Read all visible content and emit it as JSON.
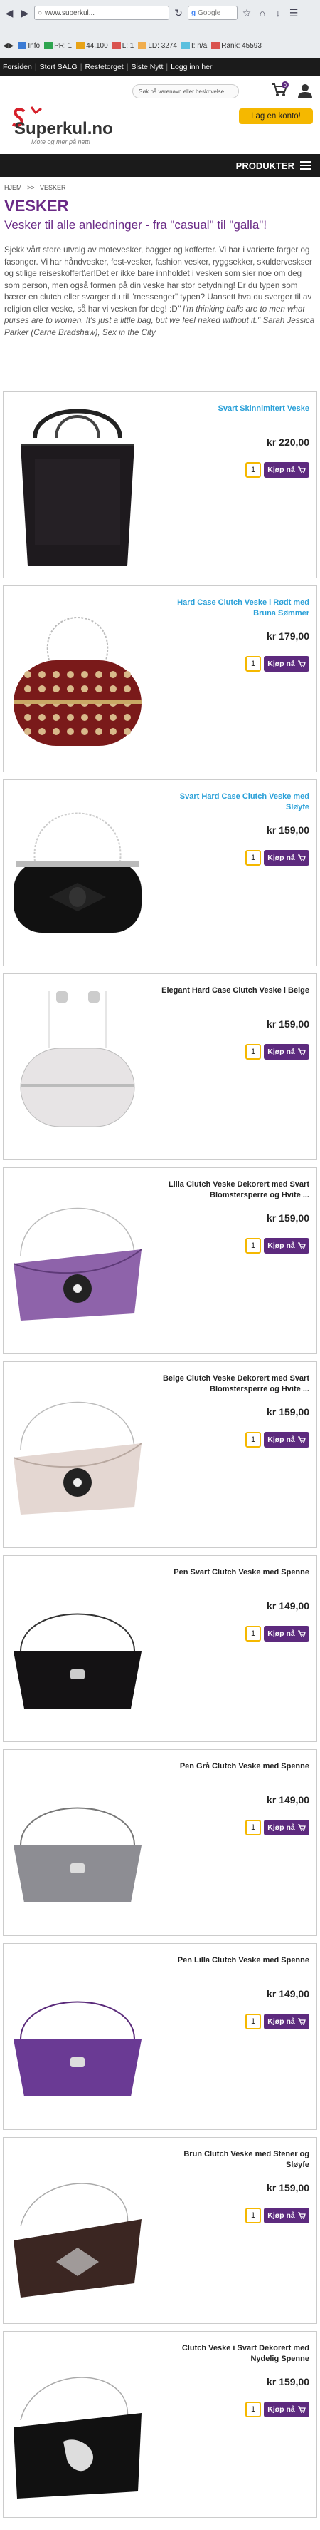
{
  "browser": {
    "url": "www.superkul...",
    "search_placeholder": "Google",
    "toolbar_items": [
      {
        "label": "Info",
        "icon": "info-icon"
      },
      {
        "label": "PR: 1",
        "icon": "pagerank-icon"
      },
      {
        "label": "44,100",
        "icon": "alexa-icon"
      },
      {
        "label": "L: 1",
        "icon": "links-icon"
      },
      {
        "label": "LD: 3274",
        "icon": "linking-domains-icon"
      },
      {
        "label": "I: n/a",
        "icon": "index-icon"
      },
      {
        "label": "Rank: 45593",
        "icon": "rank-icon"
      }
    ]
  },
  "topnav": {
    "items": [
      "Forsiden",
      "Stort SALG",
      "Restetorget",
      "Siste Nytt",
      "Logg inn her"
    ]
  },
  "header": {
    "search_placeholder": "Søk på varenavn eller beskrivelse",
    "cart_count": "0",
    "logo_text": "Superkul.no",
    "logo_tagline": "Mote og mer på nett!",
    "login_label": "Lag en konto!"
  },
  "produkter_label": "PRODUKTER",
  "breadcrumb": [
    "HJEM",
    "VESKER"
  ],
  "page": {
    "title": "VESKER",
    "subtitle": "Vesker til alle anledninger - fra \"casual\" til \"galla\"!",
    "desc_main": "Sjekk vårt store utvalg av motevesker, bagger og kofferter. Vi har i varierte farger og fasonger. Vi har håndvesker, fest-vesker, fashion vesker, ryggsekker, skulderveskser og stilige reiseskoffert\\er!Det er ikke bare innholdet i vesken som sier noe om deg som person, men også formen på din veske har stor betydning! Er du typen som bærer en clutch eller svarger du til \"messenger\" typen? Uansett hva du sverger til av religion eller veske, så har vi vesken for deg! :D",
    "desc_quote": "\" I'm thinking balls are to men what purses are to women. It's just a little bag, but we feel naked without it.\" Sarah Jessica Parker (Carrie Bradshaw), Sex in the City"
  },
  "buy_label": "Kjøp nå",
  "products": [
    {
      "name": "Svart Skinnimitert Veske",
      "price": "kr 220,00",
      "qty": "1",
      "highlight": true,
      "bag": "tote-black"
    },
    {
      "name": "Hard Case Clutch Veske i Rødt med Bruna Sømmer",
      "price": "kr 179,00",
      "qty": "1",
      "highlight": true,
      "bag": "red-clutch"
    },
    {
      "name": "Svart Hard Case Clutch Veske med Sløyfe",
      "price": "kr 159,00",
      "qty": "1",
      "highlight": true,
      "bag": "black-bow"
    },
    {
      "name": "Elegant Hard Case Clutch Veske i Beige",
      "price": "kr 159,00",
      "qty": "1",
      "highlight": false,
      "bag": "beige-hard"
    },
    {
      "name": "Lilla Clutch Veske Dekorert med Svart Blomstersperre og Hvite ...",
      "price": "kr 159,00",
      "qty": "1",
      "highlight": false,
      "bag": "purple-flower"
    },
    {
      "name": "Beige Clutch Veske Dekorert med Svart Blomstersperre og Hvite ...",
      "price": "kr 159,00",
      "qty": "1",
      "highlight": false,
      "bag": "beige-flower"
    },
    {
      "name": "Pen Svart Clutch Veske med Spenne",
      "price": "kr 149,00",
      "qty": "1",
      "highlight": false,
      "bag": "black-pleat"
    },
    {
      "name": "Pen Grå Clutch Veske med Spenne",
      "price": "kr 149,00",
      "qty": "1",
      "highlight": false,
      "bag": "grey-pleat"
    },
    {
      "name": "Pen Lilla Clutch Veske med Spenne",
      "price": "kr 149,00",
      "qty": "1",
      "highlight": false,
      "bag": "purple-pleat"
    },
    {
      "name": "Brun Clutch Veske med Stener og Sløyfe",
      "price": "kr 159,00",
      "qty": "1",
      "highlight": false,
      "bag": "brown-bow"
    },
    {
      "name": "Clutch Veske i Svart Dekorert med Nydelig Spenne",
      "price": "kr 159,00",
      "qty": "1",
      "highlight": false,
      "bag": "black-bird"
    }
  ]
}
